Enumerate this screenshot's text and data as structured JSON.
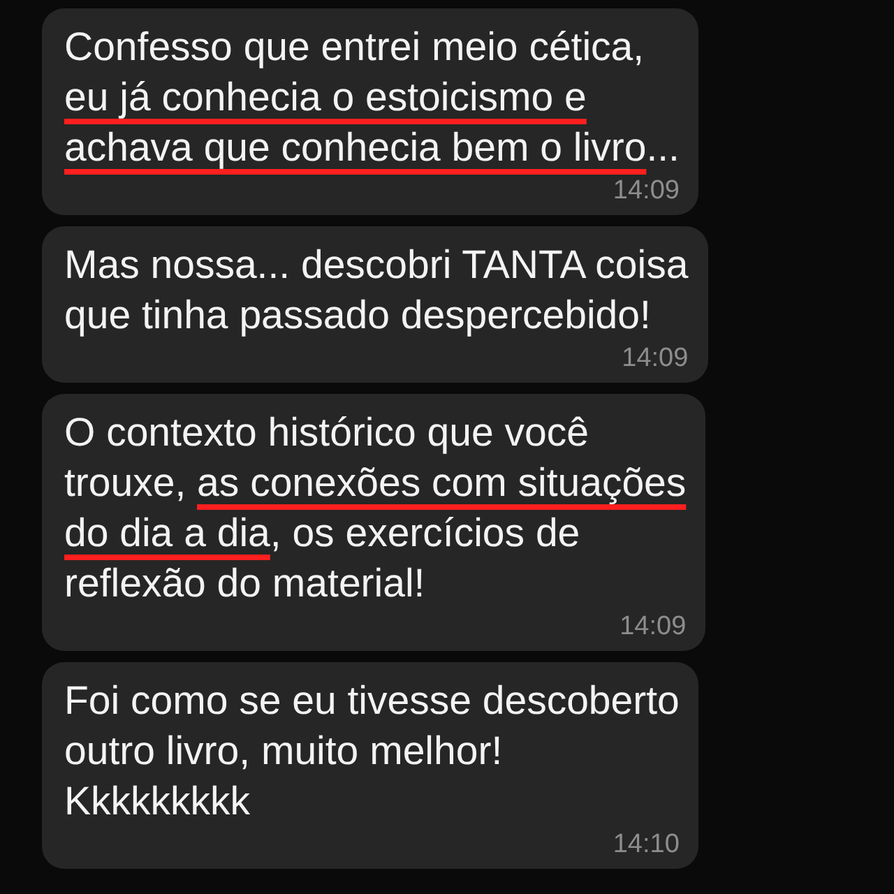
{
  "messages": [
    {
      "segments": [
        {
          "text": "Confesso que entrei meio cética,\n",
          "underlined": false
        },
        {
          "text": "eu já conhecia o estoicismo e\nachava que conhecia bem o livro",
          "underlined": true
        },
        {
          "text": "...",
          "underlined": false
        }
      ],
      "time": "14:09"
    },
    {
      "segments": [
        {
          "text": "Mas nossa... descobri TANTA coisa\nque tinha passado despercebido!",
          "underlined": false
        }
      ],
      "time": "14:09"
    },
    {
      "segments": [
        {
          "text": "O contexto histórico que você\ntrouxe, ",
          "underlined": false
        },
        {
          "text": "as conexões com situações\ndo dia a dia",
          "underlined": true
        },
        {
          "text": ", os exercícios de\nreflexão do material!",
          "underlined": false
        }
      ],
      "time": "14:09"
    },
    {
      "segments": [
        {
          "text": "Foi como se eu tivesse descoberto\noutro livro, muito melhor!\nKkkkkkkkk",
          "underlined": false
        }
      ],
      "time": "14:10"
    }
  ]
}
